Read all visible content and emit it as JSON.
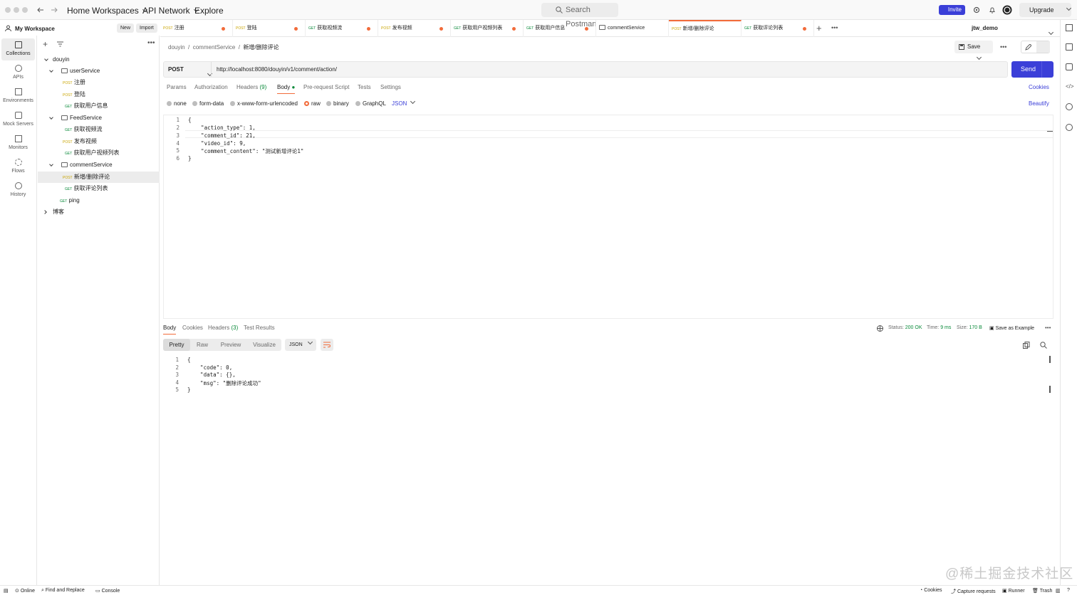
{
  "topbar": {
    "nav": [
      "Home",
      "Workspaces",
      "API Network",
      "Explore"
    ],
    "search_placeholder": "Search Postman",
    "invite": "Invite",
    "upgrade": "Upgrade"
  },
  "workspace": {
    "name": "My Workspace",
    "new": "New",
    "import": "Import"
  },
  "rail": [
    "Collections",
    "APIs",
    "Environments",
    "Mock Servers",
    "Monitors",
    "Flows",
    "History"
  ],
  "tree": {
    "root": "douyin",
    "userService": "userService",
    "u1": "注册",
    "u2": "登陆",
    "u3": "获取用户信息",
    "feed": "FeedService",
    "f1": "获取视频流",
    "f2": "发布视频",
    "f3": "获取用户视频列表",
    "comment": "commentService",
    "c1": "新增/删除评论",
    "c2": "获取评论列表",
    "ping": "ping",
    "blog": "博客",
    "post": "POST",
    "get": "GET"
  },
  "tabs": [
    {
      "method": "POST",
      "name": "注册"
    },
    {
      "method": "POST",
      "name": "登陆"
    },
    {
      "method": "GET",
      "name": "获取视频流"
    },
    {
      "method": "POST",
      "name": "发布视频"
    },
    {
      "method": "GET",
      "name": "获取用户视频列表"
    },
    {
      "method": "GET",
      "name": "获取用户信息"
    },
    {
      "method": "",
      "name": "commentService"
    },
    {
      "method": "POST",
      "name": "新增/删除评论"
    },
    {
      "method": "GET",
      "name": "获取评论列表"
    }
  ],
  "env": "jtw_demo",
  "breadcrumb": {
    "a": "douyin",
    "b": "commentService",
    "cur": "新增/删除评论",
    "sep": "/"
  },
  "save": "Save",
  "request": {
    "method": "POST",
    "url": "http://localhost:8080/douyin/v1/comment/action/",
    "send": "Send"
  },
  "req_tabs": [
    "Params",
    "Authorization",
    "Headers",
    "(9)",
    "Body",
    "Pre-request Script",
    "Tests",
    "Settings"
  ],
  "cookies": "Cookies",
  "beautify": "Beautify",
  "body_types": [
    "none",
    "form-data",
    "x-www-form-urlencoded",
    "raw",
    "binary",
    "GraphQL"
  ],
  "body_lang": "JSON",
  "request_body_lines": [
    "{",
    "    \"action_type\": 1,",
    "    \"comment_id\": 21,",
    "    \"video_id\": 9,",
    "    \"comment_content\": \"测试新增评论1\"",
    "}"
  ],
  "resp_tabs": [
    "Body",
    "Cookies",
    "Headers",
    "(3)",
    "Test Results"
  ],
  "resp_meta": {
    "status_label": "Status:",
    "status": "200 OK",
    "time_label": "Time:",
    "time": "9 ms",
    "size_label": "Size:",
    "size": "170 B",
    "save_example": "Save as Example"
  },
  "resp_views": [
    "Pretty",
    "Raw",
    "Preview",
    "Visualize"
  ],
  "resp_format": "JSON",
  "response_body_lines": [
    "{",
    "    \"code\": 0,",
    "    \"data\": {},",
    "    \"msg\": \"删除评论成功\"",
    "}"
  ],
  "statusbar": {
    "online": "Online",
    "find": "Find and Replace",
    "console": "Console",
    "cookies": "Cookies",
    "capture": "Capture requests",
    "runner": "Runner",
    "trash": "Trash"
  },
  "watermark": "@稀土掘金技术社区"
}
